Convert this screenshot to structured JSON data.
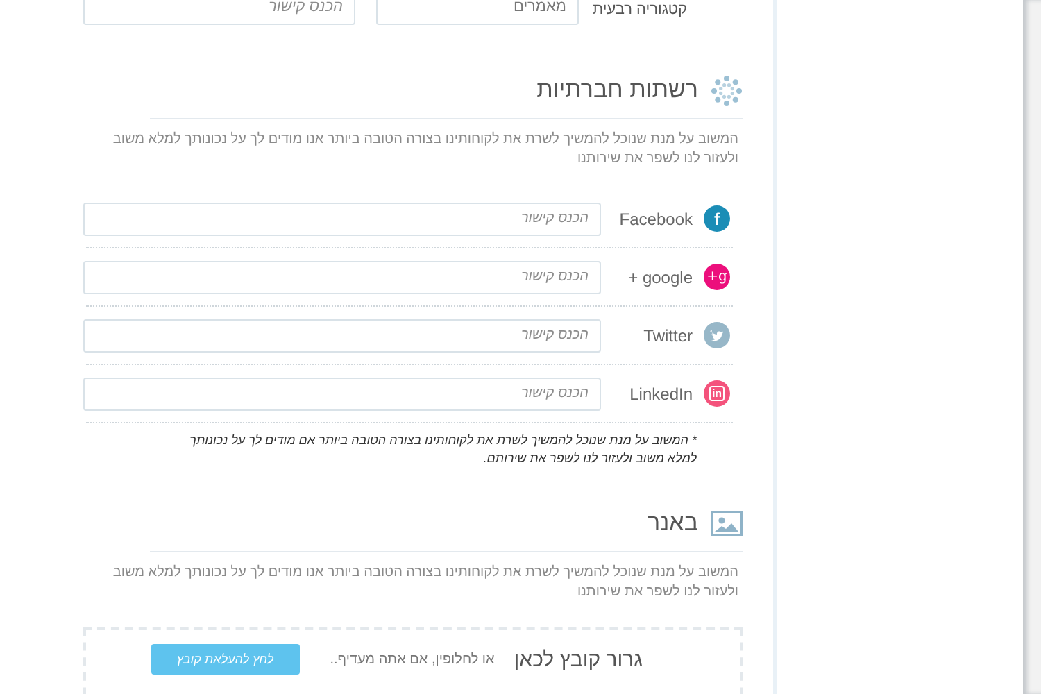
{
  "top_row": {
    "label": "קטגוריה רבעית",
    "fields": [
      {
        "value": "מאמרים"
      },
      {
        "placeholder": "הכנס קישור"
      }
    ]
  },
  "social_section": {
    "title": "רשתות חברתיות",
    "description": "המשוב על מנת שנוכל להמשיך לשרת את לקוחותינו בצורה הטובה ביותר אנו מודים לך על נכונותך למלא משוב\nולעזור לנו לשפר את שירותנו",
    "networks": [
      {
        "name": "Facebook",
        "kind": "facebook",
        "glyph": "f",
        "placeholder": "הכנס קישור"
      },
      {
        "name": "google +",
        "kind": "google",
        "glyph": "g+",
        "placeholder": "הכנס קישור"
      },
      {
        "name": "Twitter",
        "kind": "twitter",
        "placeholder": "הכנס קישור"
      },
      {
        "name": "LinkedIn",
        "kind": "linkedin",
        "glyph": "in",
        "placeholder": "הכנס קישור"
      }
    ],
    "note": "* המשוב על מנת שנוכל להמשיך לשרת את לקוחותינו בצורה הטובה ביותר אם מודים לך על נכונותך\nלמלא משוב ולעזור לנו לשפר את שירותם."
  },
  "banner_section": {
    "title": "באנר",
    "description": "המשוב על מנת שנוכל להמשיך לשרת את לקוחותינו בצורה הטובה ביותר אנו מודים לך על נכונותך למלא משוב\nולעזור לנו לשפר את שירותנו",
    "dropzone": {
      "title": "גרור קובץ לכאן",
      "alternative": "או לחלופין, אם אתה מעדיף..",
      "button": "לחץ להעלאת קובץ"
    }
  }
}
